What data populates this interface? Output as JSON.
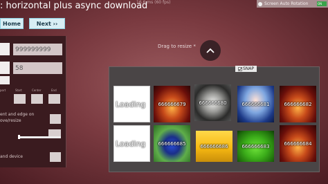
{
  "header": {
    "title": ": horizontal plus async download",
    "fps": "16.6 ms (60 fps)",
    "rotation_label": "Screen Auto Rotation",
    "rotation_toggle": "ON"
  },
  "nav": {
    "home_label": "Home",
    "next_label": "Next ››"
  },
  "panel": {
    "field1_value": "999999999",
    "field2_value": "58",
    "labels": {
      "lbl1": "ent and edge on",
      "lbl2": "ove/resize",
      "lbl3": "and device",
      "start": "Start",
      "center": "Center",
      "end": "End",
      "port": "port"
    }
  },
  "main": {
    "drag_hint": "Drag to resize",
    "snap_label": "SNAP",
    "cells": [
      {
        "label": "Loading",
        "kind": "loading"
      },
      {
        "label": "666666679",
        "kind": "fire"
      },
      {
        "label": "666666680",
        "kind": "raccoon"
      },
      {
        "label": "666666681",
        "kind": "anime"
      },
      {
        "label": "666666682",
        "kind": "fire"
      },
      {
        "label": "Loading",
        "kind": "loading"
      },
      {
        "label": "666666685",
        "kind": "butterfly"
      },
      {
        "label": "666666686",
        "kind": "folder"
      },
      {
        "label": "666666683",
        "kind": "green"
      },
      {
        "label": "666666684",
        "kind": "fire"
      }
    ]
  }
}
